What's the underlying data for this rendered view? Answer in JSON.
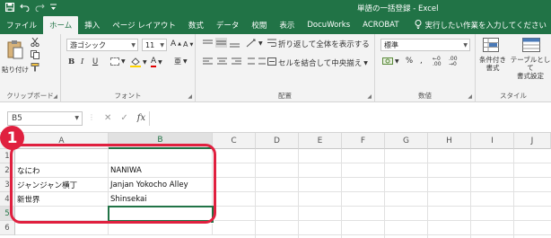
{
  "window": {
    "title": "単語の一括登録 - Excel",
    "qa_icons": [
      "save-icon",
      "undo-icon",
      "redo-icon",
      "customize-icon"
    ]
  },
  "tabs": [
    {
      "label": "ファイル",
      "active": false
    },
    {
      "label": "ホーム",
      "active": true
    },
    {
      "label": "挿入",
      "active": false
    },
    {
      "label": "ページ レイアウト",
      "active": false
    },
    {
      "label": "数式",
      "active": false
    },
    {
      "label": "データ",
      "active": false
    },
    {
      "label": "校閲",
      "active": false
    },
    {
      "label": "表示",
      "active": false
    },
    {
      "label": "DocuWorks",
      "active": false
    },
    {
      "label": "ACROBAT",
      "active": false
    }
  ],
  "tell_me": "実行したい作業を入力してください",
  "ribbon": {
    "clipboard": {
      "paste_label": "貼り付け",
      "group_label": "クリップボード"
    },
    "font": {
      "font_name": "游ゴシック",
      "font_size": "11",
      "group_label": "フォント",
      "bold": "B",
      "italic": "I",
      "underline": "U"
    },
    "alignment": {
      "wrap_text": "折り返して全体を表示する",
      "merge_center": "セルを結合して中央揃え",
      "group_label": "配置"
    },
    "number": {
      "format": "標準",
      "percent": "%",
      "comma": ",",
      "group_label": "数値"
    },
    "styles": {
      "conditional": "条件付き\n書式",
      "table": "テーブルとして\n書式設定",
      "group_label": "スタイル"
    }
  },
  "formula_bar": {
    "name_box": "B5",
    "fx": "fx",
    "value": ""
  },
  "sheet": {
    "columns": [
      "A",
      "B",
      "C",
      "D",
      "E",
      "F",
      "G",
      "H",
      "I",
      "J"
    ],
    "selected_column": "B",
    "rows": [
      {
        "num": "1",
        "cells": [
          "",
          ""
        ]
      },
      {
        "num": "2",
        "cells": [
          "なにわ",
          "NANIWA"
        ]
      },
      {
        "num": "3",
        "cells": [
          "ジャンジャン横丁",
          "Janjan Yokocho Alley"
        ]
      },
      {
        "num": "4",
        "cells": [
          "新世界",
          "Shinsekai"
        ]
      },
      {
        "num": "5",
        "cells": [
          "",
          ""
        ]
      },
      {
        "num": "6",
        "cells": [
          "",
          ""
        ]
      }
    ],
    "active_cell": "B5"
  },
  "annotation": {
    "step_number": "1",
    "color": "#e0203f"
  },
  "colors": {
    "accent": "#217346",
    "annotation": "#e0203f"
  }
}
